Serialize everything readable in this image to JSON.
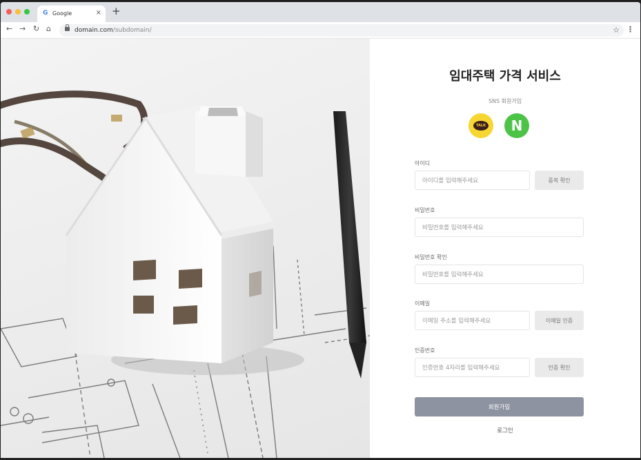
{
  "browser": {
    "tab_icon": "G",
    "tab_title": "Google",
    "close_glyph": "×",
    "new_tab_glyph": "+",
    "url_domain": "domain.com",
    "url_path": "/subdomain/",
    "traffic_lights": [
      "#f25f58",
      "#fbbe3c",
      "#33c748"
    ]
  },
  "page": {
    "title": "임대주택 가격 서비스",
    "sns_label": "SNS 회원가입",
    "kakao_text": "TALK",
    "naver_text": "N",
    "fields": {
      "id": {
        "label": "아이디",
        "placeholder": "아이디를 입력해주세요",
        "button": "중복 확인"
      },
      "password": {
        "label": "비밀번호",
        "placeholder": "비밀번호를 입력해주세요"
      },
      "password_confirm": {
        "label": "비밀번호 확인",
        "placeholder": "비밀번호를 입력해주세요"
      },
      "email": {
        "label": "이메일",
        "placeholder": "이메일 주소를 입력해주세요",
        "button": "이메일 인증"
      },
      "code": {
        "label": "인증번호",
        "placeholder": "인증번호 4자리를 입력해주세요",
        "button": "인증 확인"
      }
    },
    "submit": "회원가입",
    "login": "로그인"
  }
}
